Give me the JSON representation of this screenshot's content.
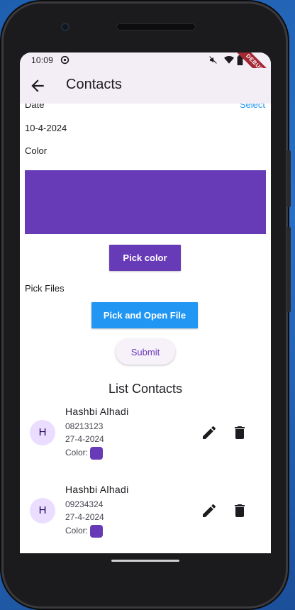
{
  "status_bar": {
    "time": "10:09"
  },
  "debug_banner": {
    "label": "DEBUG"
  },
  "app_bar": {
    "title": "Contacts"
  },
  "form": {
    "date_label": "Date",
    "date_action": "Select",
    "date_value": "10-4-2024",
    "color_label": "Color",
    "selected_color": "#673ab7",
    "pick_color_button": "Pick color",
    "pick_files_label": "Pick Files",
    "pick_file_button": "Pick and Open File",
    "submit_button": "Submit"
  },
  "list": {
    "title": "List Contacts",
    "color_prefix": "Color:",
    "contacts": [
      {
        "initial": "H",
        "name": "Hashbi Alhadi",
        "phone": "08213123",
        "date": "27-4-2024",
        "color": "#673ab7"
      },
      {
        "initial": "H",
        "name": "Hashbi Alhadi",
        "phone": "09234324",
        "date": "27-4-2024",
        "color": "#673ab7"
      }
    ]
  },
  "icons": [
    "back-arrow-icon",
    "edit-icon",
    "delete-icon",
    "wifi-icon",
    "battery-icon",
    "mute-icon",
    "settings-icon"
  ]
}
